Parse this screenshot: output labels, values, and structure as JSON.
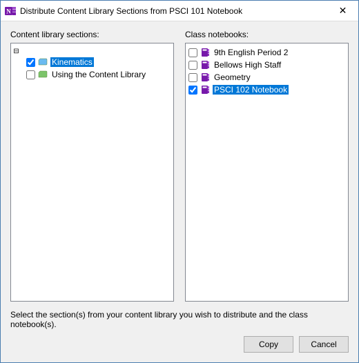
{
  "title": "Distribute Content Library Sections from PSCI 101 Notebook",
  "labels": {
    "left": "Content library sections:",
    "right": "Class notebooks:"
  },
  "sections": [
    {
      "label": "Kinematics",
      "checked": true,
      "selected": true,
      "color": "#6bbaf0"
    },
    {
      "label": "Using the Content Library",
      "checked": false,
      "selected": false,
      "color": "#7cc46a"
    }
  ],
  "notebooks": [
    {
      "label": "9th English  Period 2",
      "checked": false,
      "selected": false
    },
    {
      "label": "Bellows High Staff",
      "checked": false,
      "selected": false
    },
    {
      "label": "Geometry",
      "checked": false,
      "selected": false
    },
    {
      "label": "PSCI 102 Notebook",
      "checked": true,
      "selected": true
    }
  ],
  "instruction": "Select the section(s) from your content library you wish to distribute and the class notebook(s).",
  "buttons": {
    "copy": "Copy",
    "cancel": "Cancel"
  },
  "tree_toggle": "⊟"
}
